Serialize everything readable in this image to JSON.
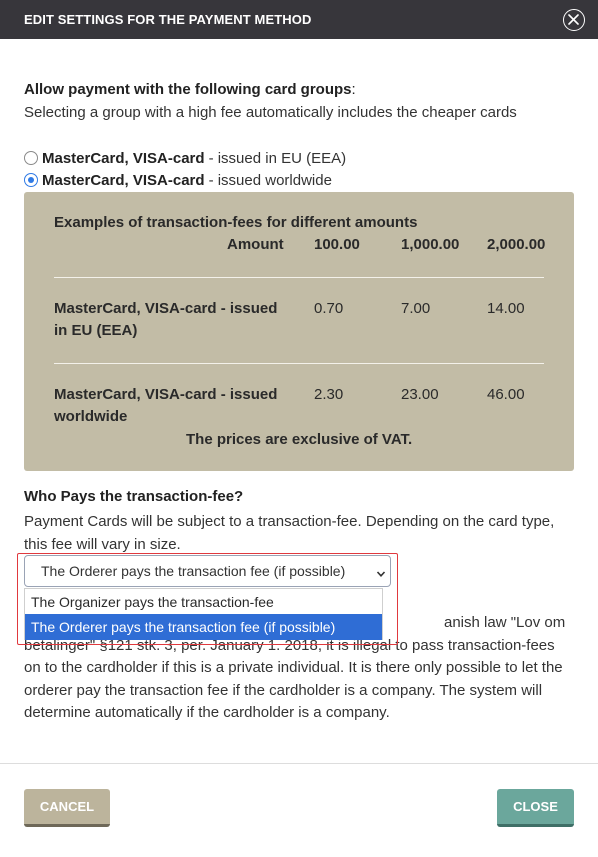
{
  "header": {
    "title": "EDIT SETTINGS FOR THE PAYMENT METHOD",
    "close_icon": "close-circle-icon"
  },
  "intro": {
    "title_bold": "Allow payment with the following card groups",
    "title_suffix": ":",
    "subtitle": "Selecting a group with a high fee automatically includes the cheaper cards"
  },
  "card_groups": [
    {
      "name": "MasterCard, VISA-card",
      "suffix": " - issued in EU (EEA)",
      "checked": false
    },
    {
      "name": "MasterCard, VISA-card",
      "suffix": " - issued worldwide",
      "checked": true
    }
  ],
  "fee_table": {
    "title": "Examples of transaction-fees for different amounts",
    "amount_label": "Amount",
    "amounts": [
      "100.00",
      "1,000.00",
      "2,000.00"
    ],
    "rows": [
      {
        "label_line1": "MasterCard, VISA-card - issued",
        "label_line2": "in EU (EEA)",
        "values": [
          "0.70",
          "7.00",
          "14.00"
        ]
      },
      {
        "label_line1": "MasterCard, VISA-card - issued",
        "label_line2": "worldwide",
        "values": [
          "2.30",
          "23.00",
          "46.00"
        ]
      }
    ],
    "footer": "The prices are exclusive of VAT."
  },
  "who_pays": {
    "title": "Who Pays the transaction-fee?",
    "description": "Payment Cards will be subject to a transaction-fee. Depending on the card type, this fee will vary in size.",
    "selected": "The Orderer pays the transaction fee (if possible)",
    "options": [
      "The Organizer pays the transaction-fee",
      "The Orderer pays the transaction fee (if possible)"
    ],
    "legal_line1": "anish law \"Lov om",
    "legal_line2": "betalinger\" §121 stk. 3, per. January 1. 2018, it is illegal to pass transaction-fees on to the cardholder if this is a private individual. It is there only possible to let the orderer pay the transaction fee if the cardholder is a company. The system will determine automatically if the cardholder is a company."
  },
  "footer": {
    "cancel_label": "CANCEL",
    "close_label": "CLOSE"
  },
  "colors": {
    "header_bg": "#37363b",
    "fee_box_bg": "#c2bca6",
    "cancel_bg": "#bcb49c",
    "close_bg": "#6ba79c",
    "selected_option_bg": "#2f6dd5",
    "focus_outline": "#e0393e",
    "radio_accent": "#2f7ae5"
  }
}
